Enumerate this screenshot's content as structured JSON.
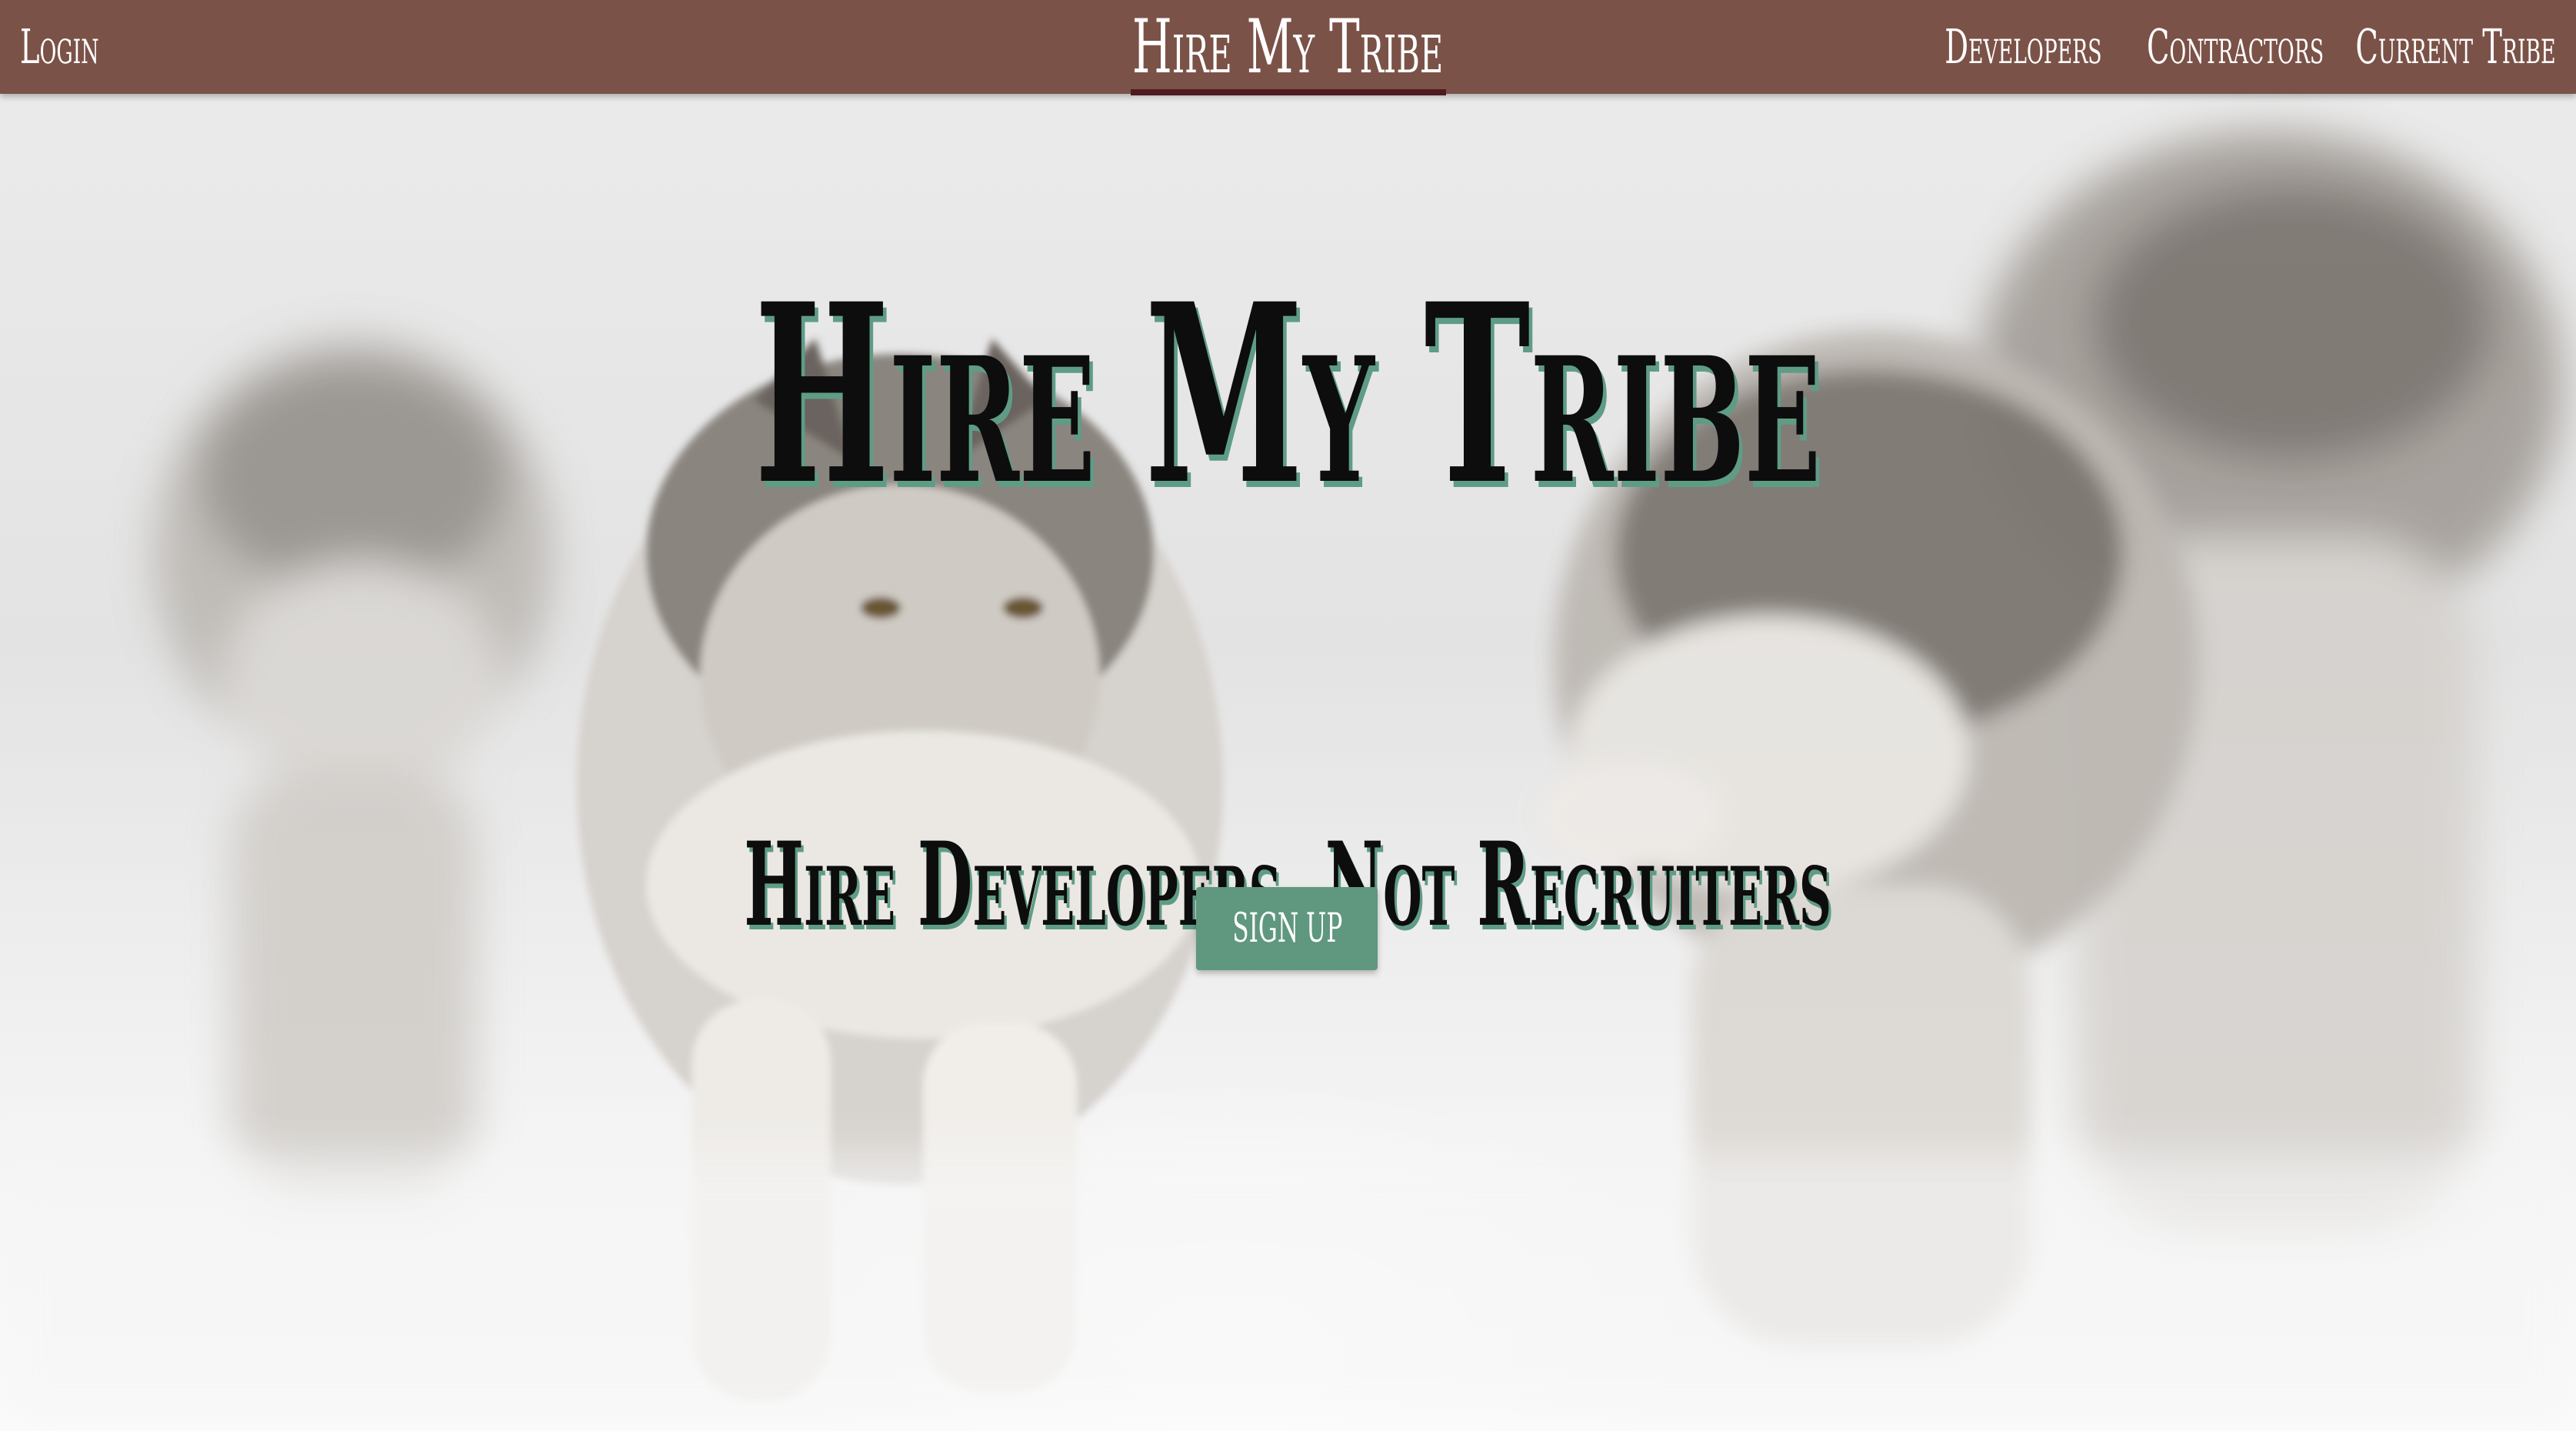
{
  "nav": {
    "login": "Login",
    "brand": "Hire My Tribe",
    "links": [
      "Developers",
      "Contractors",
      "Current Tribe"
    ]
  },
  "hero": {
    "title": "Hire My Tribe",
    "subtitle": "Hire Developers, Not Recruiters",
    "signup_label": "SIGN UP",
    "background_image": "wolf-pack-snow-image"
  },
  "colors": {
    "navbar": "#7b5248",
    "accent": "#5f977f",
    "title_shadow": "#5f9c86",
    "brand_underline": "#4d1a1f"
  }
}
